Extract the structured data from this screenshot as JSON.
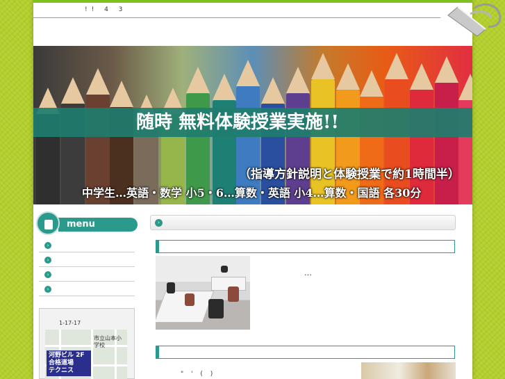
{
  "header": {
    "top_text": "!! 4 3"
  },
  "banner": {
    "headline": "随時 無料体験授業実施!!",
    "subline1": "（指導方針説明と体験授業で約1時間半）",
    "subline2": "中学生…英語・数学 小5・6…算数・英語 小4…算数・国語 各30分"
  },
  "sidebar": {
    "menu_title": "menu",
    "items": [
      {
        "label": ""
      },
      {
        "label": ""
      },
      {
        "label": ""
      },
      {
        "label": ""
      }
    ],
    "map": {
      "address": "1-17-17",
      "school": "市立山本小学校",
      "building_lines": [
        "河野ビル 2F",
        "合格道場",
        "テクニス"
      ]
    }
  },
  "main": {
    "intro_ellipsis": "…",
    "section2_quote": "\" '  (    )"
  },
  "colors": {
    "background": "#b3cf2c",
    "accent_teal": "#2b9a8c",
    "top_line": "#7cc21c",
    "map_label": "#2a2f8e"
  }
}
